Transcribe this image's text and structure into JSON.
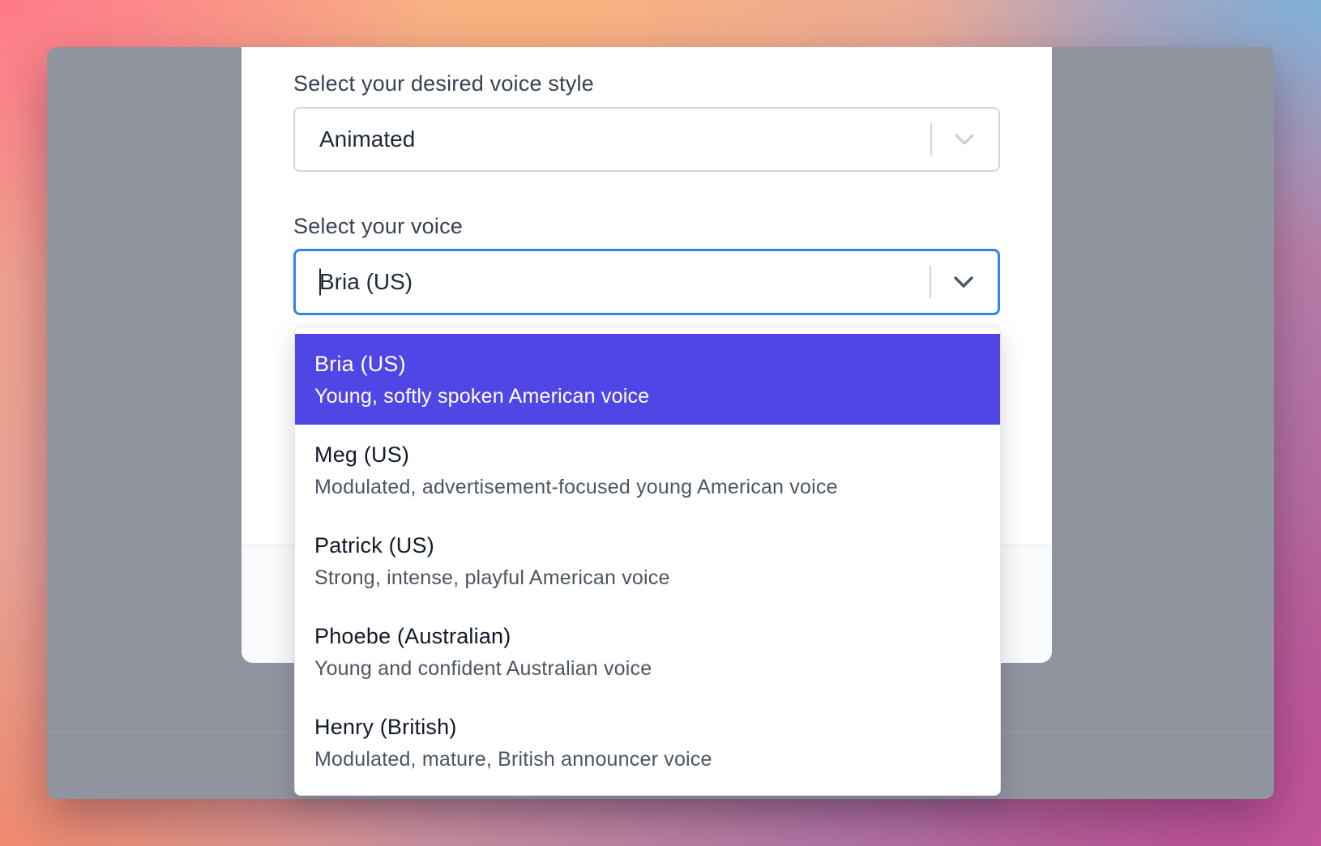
{
  "form": {
    "voice_style": {
      "label": "Select your desired voice style",
      "value": "Animated"
    },
    "voice": {
      "label": "Select your voice",
      "value": "Bria (US)"
    }
  },
  "dropdown": {
    "options": [
      {
        "name": "Bria (US)",
        "description": "Young, softly spoken American voice",
        "selected": true
      },
      {
        "name": "Meg (US)",
        "description": "Modulated, advertisement-focused young American voice",
        "selected": false
      },
      {
        "name": "Patrick (US)",
        "description": "Strong, intense, playful American voice",
        "selected": false
      },
      {
        "name": "Phoebe (Australian)",
        "description": "Young and confident Australian voice",
        "selected": false
      },
      {
        "name": "Henry (British)",
        "description": "Modulated, mature, British announcer voice",
        "selected": false
      }
    ]
  },
  "icons": {
    "style_select_indicator": "chevron-down-icon",
    "voice_select_indicator": "chevron-down-icon"
  },
  "colors": {
    "highlight": "#4f46e5",
    "focus_border": "#2f85ea",
    "overlay": "#8f949e"
  }
}
